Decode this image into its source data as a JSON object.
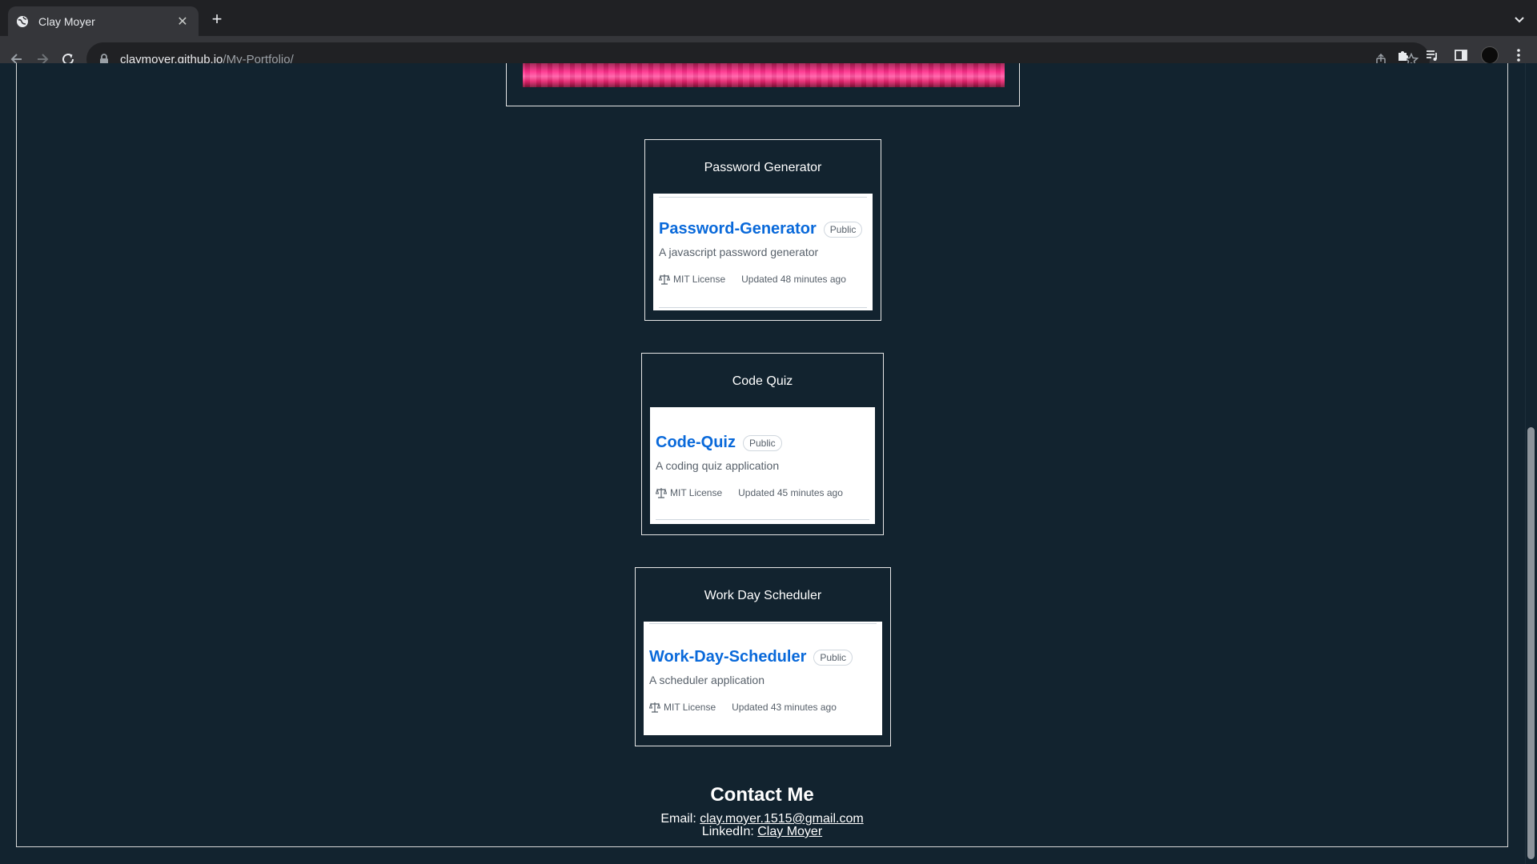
{
  "browser": {
    "tab_title": "Clay Moyer",
    "tab_close": "✕",
    "new_tab": "+",
    "url_host": "claymoyer.github.io",
    "url_path": "/My-Portfolio/"
  },
  "projects": [
    {
      "title": "Password Generator",
      "repo_name": "Password-Generator",
      "visibility": "Public",
      "description": "A javascript password generator",
      "license": "MIT License",
      "updated": "Updated 48 minutes ago"
    },
    {
      "title": "Code Quiz",
      "repo_name": "Code-Quiz",
      "visibility": "Public",
      "description": "A coding quiz application",
      "license": "MIT License",
      "updated": "Updated 45 minutes ago"
    },
    {
      "title": "Work Day Scheduler",
      "repo_name": "Work-Day-Scheduler",
      "visibility": "Public",
      "description": "A scheduler application",
      "license": "MIT License",
      "updated": "Updated 43 minutes ago"
    }
  ],
  "contact": {
    "heading": "Contact Me",
    "email_label": "Email: ",
    "email": "clay.moyer.1515@gmail.com",
    "linkedin_label": "LinkedIn: ",
    "linkedin": "Clay Moyer"
  },
  "colors": {
    "page_bg": "#12232f",
    "repo_link": "#0969da",
    "hero": "#ff2d8a"
  }
}
